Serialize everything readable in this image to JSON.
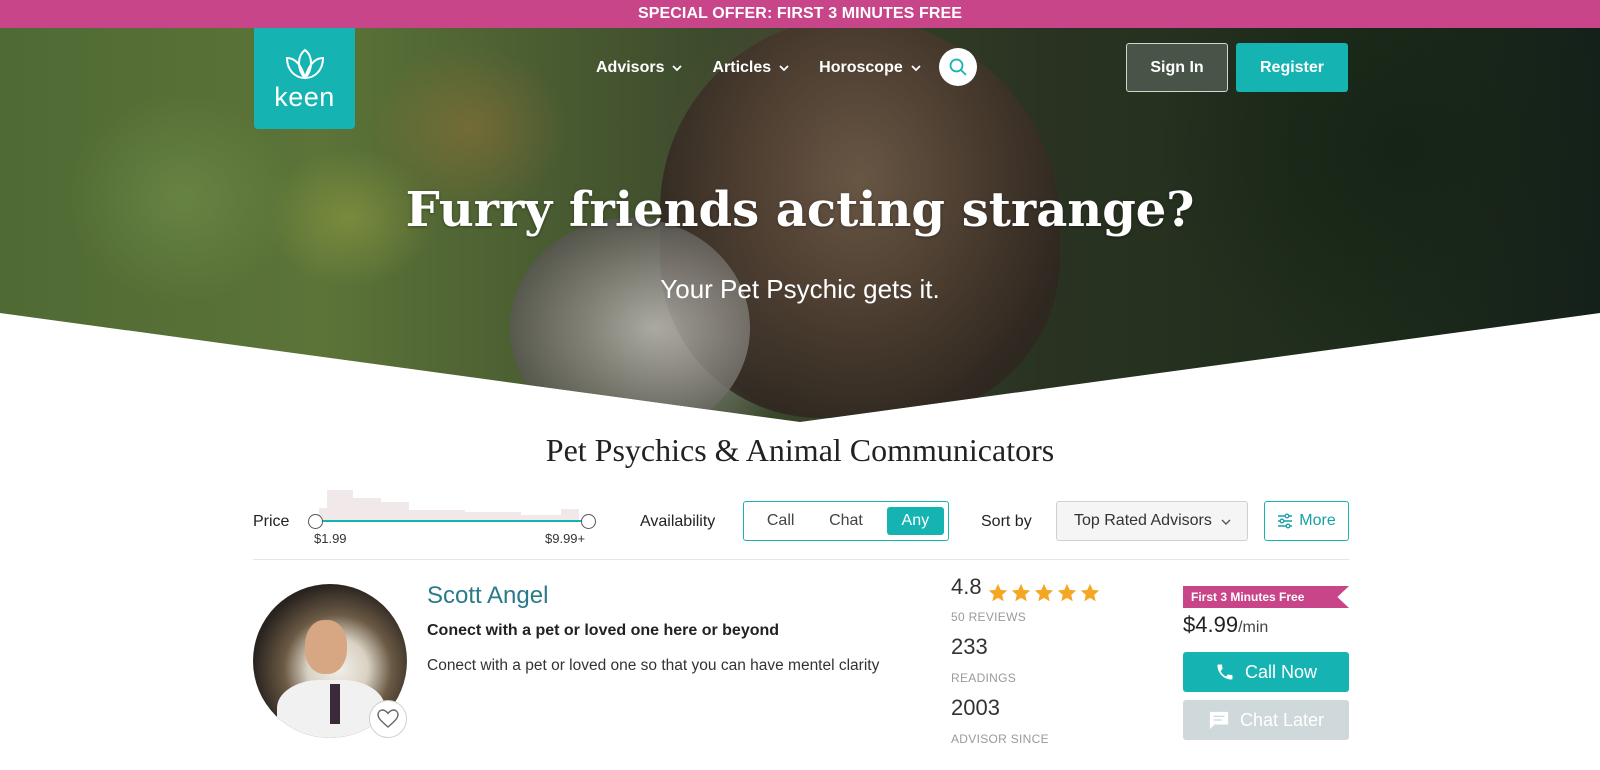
{
  "promo": {
    "text": "SPECIAL OFFER: FIRST 3 MINUTES FREE"
  },
  "header": {
    "logo_text": "keen",
    "nav": [
      {
        "label": "Advisors"
      },
      {
        "label": "Articles"
      },
      {
        "label": "Horoscope"
      }
    ],
    "search_icon": "search-icon",
    "sign_in_label": "Sign In",
    "register_label": "Register"
  },
  "hero": {
    "title": "Furry friends acting strange?",
    "subtitle": "Your Pet Psychic gets it."
  },
  "section": {
    "title": "Pet Psychics & Animal Communicators"
  },
  "filters": {
    "price_label": "Price",
    "price_min": "$1.99",
    "price_max": "$9.99+",
    "availability_label": "Availability",
    "availability_options": [
      "Call",
      "Chat",
      "Any"
    ],
    "availability_selected": "Any",
    "sort_label": "Sort by",
    "sort_value": "Top Rated Advisors",
    "more_label": "More"
  },
  "advisor": {
    "name": "Scott Angel",
    "tagline": "Conect with a pet or loved one here or beyond",
    "description": "Conect with a pet or loved one so that you can have mentel clarity",
    "rating": "4.8",
    "rating_stars": 5,
    "reviews": "50 REVIEWS",
    "readings": "233",
    "readings_label": "READINGS",
    "since": "2003",
    "since_label": "ADVISOR SINCE",
    "offer_ribbon": "First 3 Minutes Free",
    "price": "$4.99",
    "price_unit": "/min",
    "call_label": "Call Now",
    "chat_label": "Chat Later"
  },
  "colors": {
    "brand_teal": "#16b3b3",
    "promo_pink": "#c94589",
    "star_gold": "#f5a623"
  }
}
